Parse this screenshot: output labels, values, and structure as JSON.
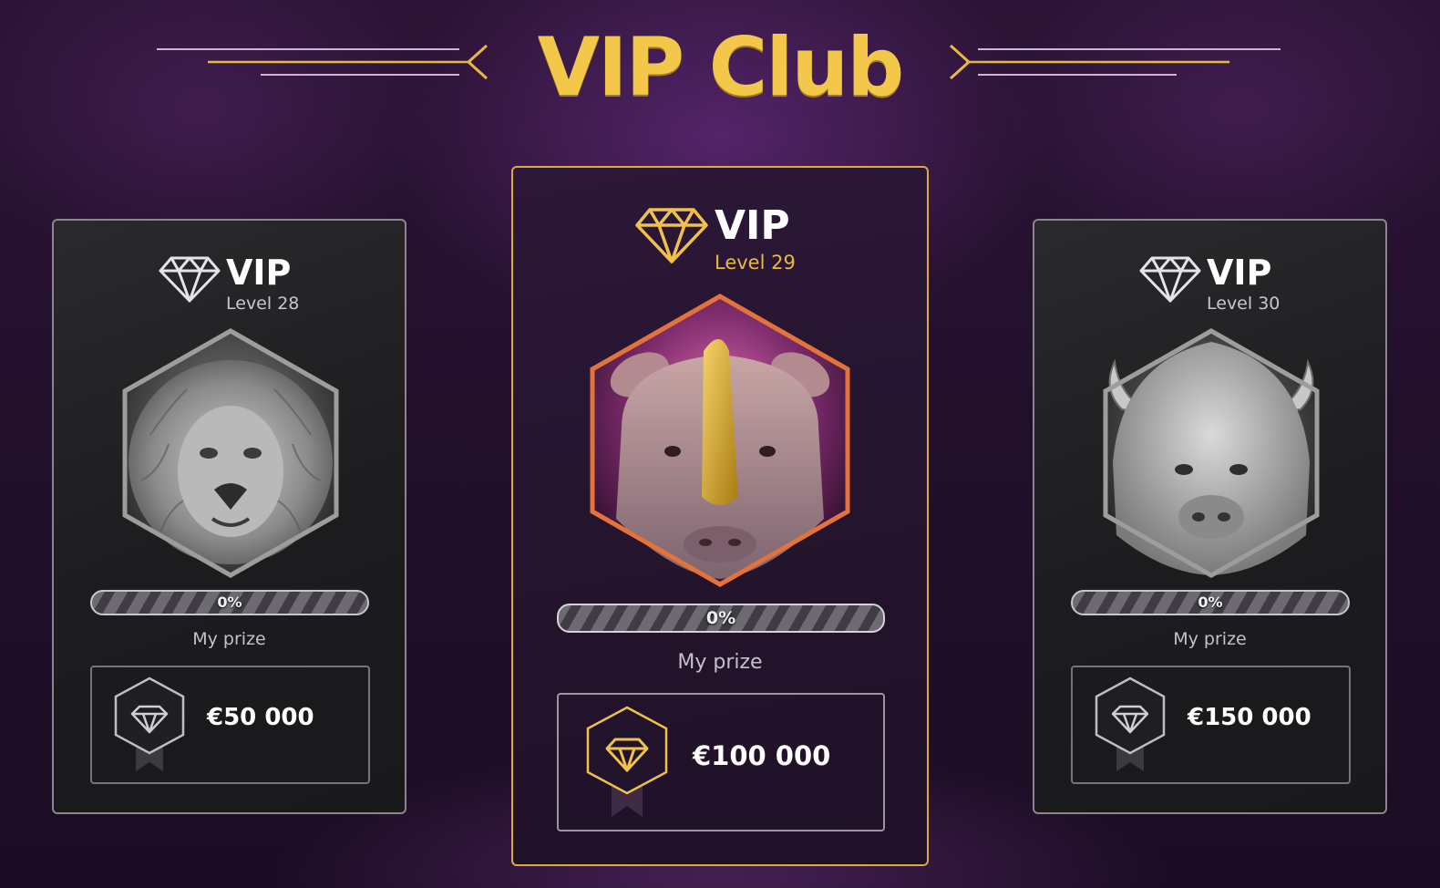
{
  "page": {
    "title": "VIP Club"
  },
  "colors": {
    "gold": "#f3c84a",
    "silver": "#c8c6cc",
    "background": "#22102b"
  },
  "cards": [
    {
      "vip_label": "VIP",
      "level": "Level 28",
      "animal_icon": "lion-icon",
      "progress_percent": 0,
      "progress_text": "0%",
      "prize_label": "My prize",
      "prize_amount": "€50 000"
    },
    {
      "vip_label": "VIP",
      "level": "Level 29",
      "animal_icon": "rhino-icon",
      "progress_percent": 0,
      "progress_text": "0%",
      "prize_label": "My prize",
      "prize_amount": "€100 000"
    },
    {
      "vip_label": "VIP",
      "level": "Level 30",
      "animal_icon": "buffalo-icon",
      "progress_percent": 0,
      "progress_text": "0%",
      "prize_label": "My prize",
      "prize_amount": "€150 000"
    }
  ]
}
